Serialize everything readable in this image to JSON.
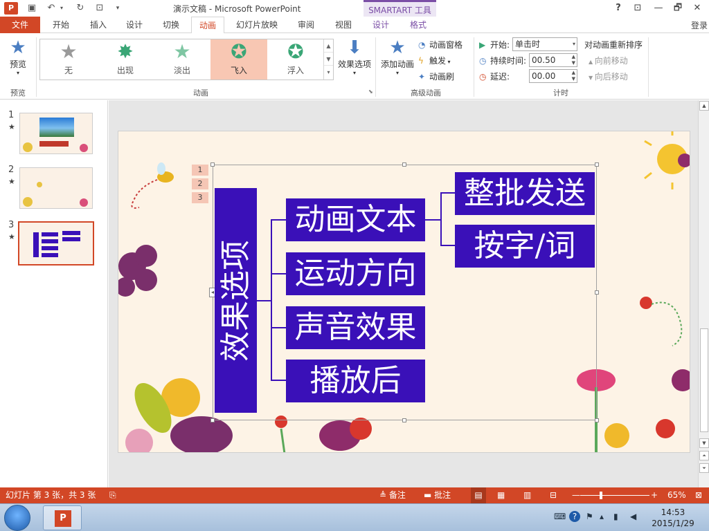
{
  "titlebar": {
    "app_icon": "P",
    "title": "演示文稿 - Microsoft PowerPoint",
    "smartart_tools": "SMARTART 工具",
    "help": "?",
    "restore_ribbon": "⊡",
    "minimize": "🗕",
    "maximize": "🗗",
    "close": "✕"
  },
  "tabs": {
    "file": "文件",
    "home": "开始",
    "insert": "插入",
    "design": "设计",
    "transitions": "切换",
    "animations": "动画",
    "slideshow": "幻灯片放映",
    "review": "审阅",
    "view": "视图",
    "smart_design": "设计",
    "smart_format": "格式",
    "login": "登录"
  },
  "ribbon": {
    "preview": "预览",
    "preview_group": "预览",
    "gallery": [
      {
        "label": "无",
        "color": "#9a9a9a"
      },
      {
        "label": "出现",
        "color": "#3aa676"
      },
      {
        "label": "淡出",
        "color": "#7fc6a3"
      },
      {
        "label": "飞入",
        "color": "#3aa676"
      },
      {
        "label": "浮入",
        "color": "#3aa676"
      }
    ],
    "effect_options": "效果选项",
    "animation_group": "动画",
    "add_animation": "添加动画",
    "animation_pane": "动画窗格",
    "trigger": "触发",
    "animation_painter": "动画刷",
    "advanced_group": "高级动画",
    "start_label": "开始:",
    "start_value": "单击时",
    "duration_label": "持续时间:",
    "duration_value": "00.50",
    "delay_label": "延迟:",
    "delay_value": "00.00",
    "timing_group": "计时",
    "reorder": "对动画重新排序",
    "move_earlier": "向前移动",
    "move_later": "向后移动"
  },
  "thumbnails": [
    {
      "num": "1",
      "mark": "★"
    },
    {
      "num": "2",
      "mark": "★"
    },
    {
      "num": "3",
      "mark": "★"
    }
  ],
  "slide": {
    "main_label": "效果选项",
    "boxes": [
      "动画文本",
      "运动方向",
      "声音效果",
      "播放后"
    ],
    "sub_boxes": [
      "整批发送",
      "按字/词"
    ],
    "anim_tags": [
      "1",
      "2",
      "3"
    ]
  },
  "statusbar": {
    "slide_info": "幻灯片 第 3 张，共 3 张",
    "notes": "备注",
    "comments": "批注",
    "zoom": "65%"
  },
  "taskbar": {
    "time": "14:53",
    "date": "2015/1/29"
  },
  "colors": {
    "accent": "#d24726",
    "smartart_fill": "#3a10b8",
    "smartart_tab": "#7b4ea6"
  }
}
